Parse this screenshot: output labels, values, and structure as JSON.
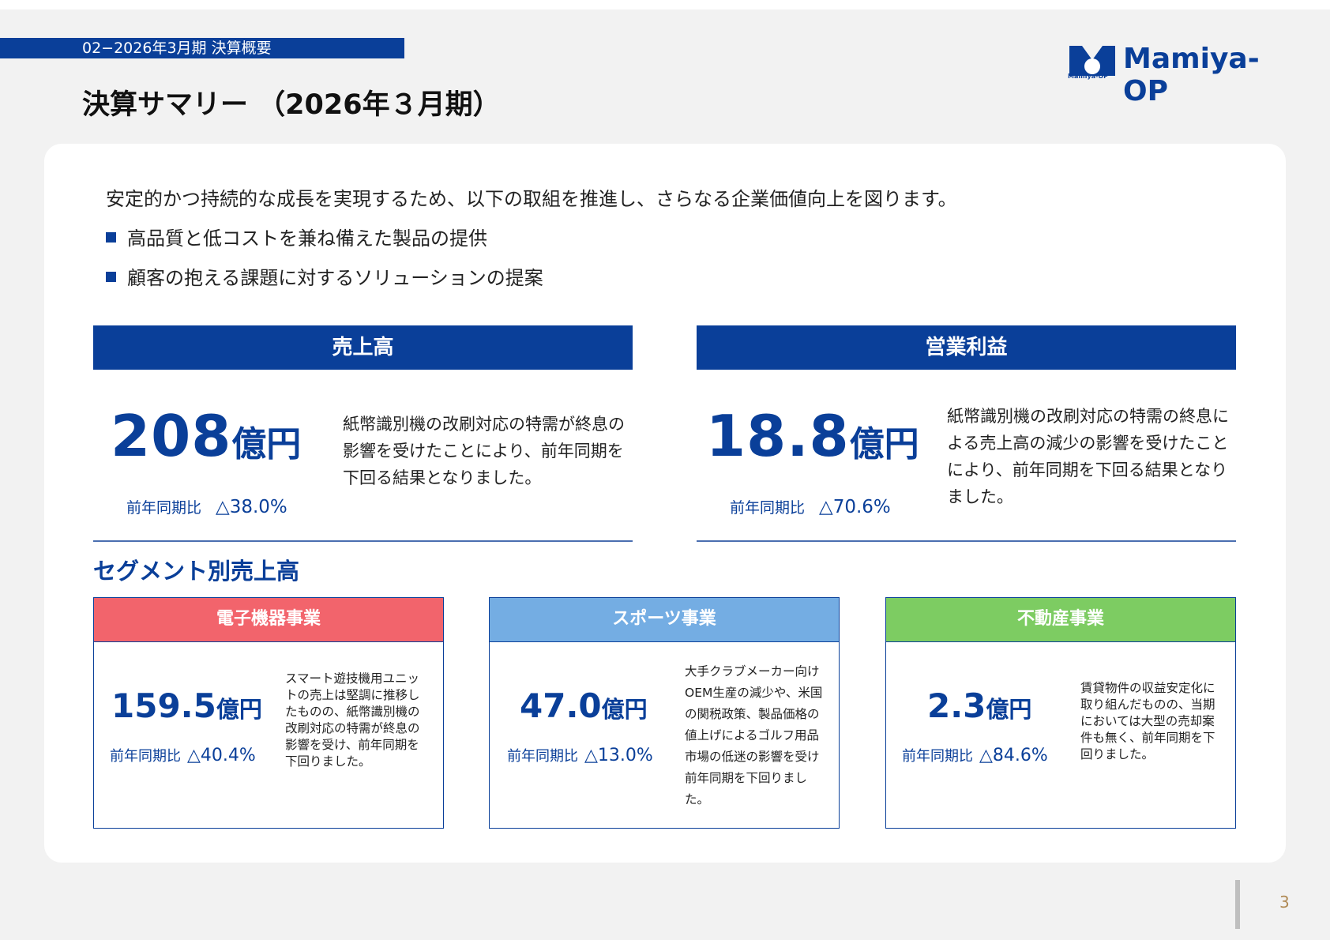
{
  "header": {
    "section_label": "02−2026年3月期 決算概要",
    "logo_text": "Mamiya-OP",
    "logo_subtext": "Mamiya-OP",
    "page_title": "決算サマリー （2026年３月期）"
  },
  "intro": {
    "lead": "安定的かつ持続的な成長を実現するため、以下の取組を推進し、さらなる企業価値向上を図ります。",
    "bullets": [
      "高品質と低コストを兼ね備えた製品の提供",
      "顧客の抱える課題に対するソリューションの提案"
    ]
  },
  "kpis": [
    {
      "header": "売上高",
      "value": "208",
      "unit": "億円",
      "yoy_label": "前年同期比",
      "yoy_value": "△38.0%",
      "description": "紙幣識別機の改刷対応の特需が終息の影響を受けたことにより、前年同期を下回る結果となりました。"
    },
    {
      "header": "営業利益",
      "value": "18.8",
      "unit": "億円",
      "yoy_label": "前年同期比",
      "yoy_value": "△70.6%",
      "description": "紙幣識別機の改刷対応の特需の終息による売上高の減少の影響を受けたことにより、前年同期を下回る結果となりました。"
    }
  ],
  "segments": {
    "title": "セグメント別売上高",
    "items": [
      {
        "header": "電子機器事業",
        "value": "159.5",
        "unit": "億円",
        "yoy_label": "前年同期比",
        "yoy_value": "△40.4%",
        "description": "スマート遊技機用ユニットの売上は堅調に推移したものの、紙幣識別機の改刷対応の特需が終息の影響を受け、前年同期を下回りました。"
      },
      {
        "header": "スポーツ事業",
        "value": "47.0",
        "unit": "億円",
        "yoy_label": "前年同期比",
        "yoy_value": "△13.0%",
        "description": "大手クラブメーカー向けOEM生産の減少や、米国の関税政策、製品価格の値上げによるゴルフ用品市場の低迷の影響を受け前年同期を下回りました。"
      },
      {
        "header": "不動産事業",
        "value": "2.3",
        "unit": "億円",
        "yoy_label": "前年同期比",
        "yoy_value": "△84.6%",
        "description": "賃貸物件の収益安定化に取り組んだものの、当期においては大型の売却案件も無く、前年同期を下回りました。"
      }
    ]
  },
  "footer": {
    "page_number": "3"
  },
  "colors": {
    "brand_blue": "#0a3f99",
    "segment_electronics": "#f2646c",
    "segment_sports": "#74ade3",
    "segment_realestate": "#7dcc62"
  }
}
